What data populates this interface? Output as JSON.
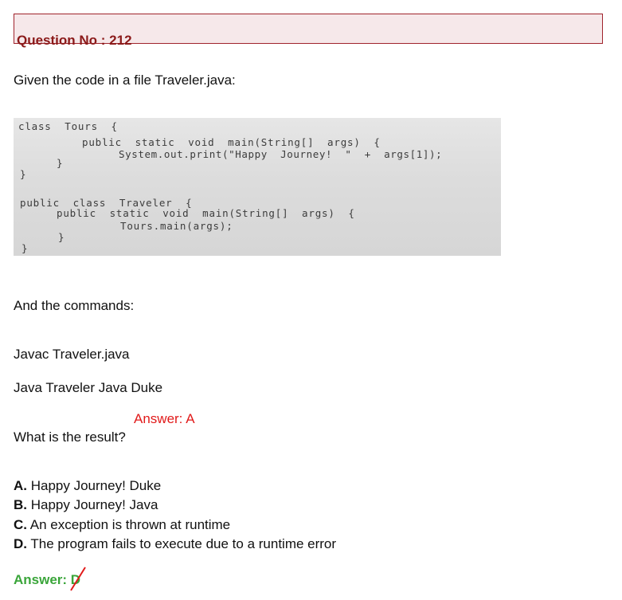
{
  "question": {
    "title": "Question No : 212"
  },
  "intro": "Given the code in a file Traveler.java:",
  "code_lines": [
    "class  Tours  {",
    "public  static  void  main(String[]  args)  {",
    "System.out.print(\"Happy  Journey!  \"  +  args[1]);",
    "}",
    "}",
    "public  class  Traveler  {",
    "public  static  void  main(String[]  args)  {",
    "Tours.main(args);",
    "}",
    "}"
  ],
  "commands_intro": "And the commands:",
  "command_1": "Javac Traveler.java",
  "command_2": "Java Traveler Java Duke",
  "overlay_answer": "Answer: A",
  "prompt": "What is the result?",
  "options": [
    {
      "letter": "A.",
      "text": " Happy Journey! Duke"
    },
    {
      "letter": "B.",
      "text": " Happy Journey! Java"
    },
    {
      "letter": "C.",
      "text": " An exception is thrown at runtime"
    },
    {
      "letter": "D.",
      "text": " The program fails to execute due to a runtime error"
    }
  ],
  "answer": {
    "label": "Answer: ",
    "letter": "D",
    "strike_color": "#e11a1a"
  }
}
